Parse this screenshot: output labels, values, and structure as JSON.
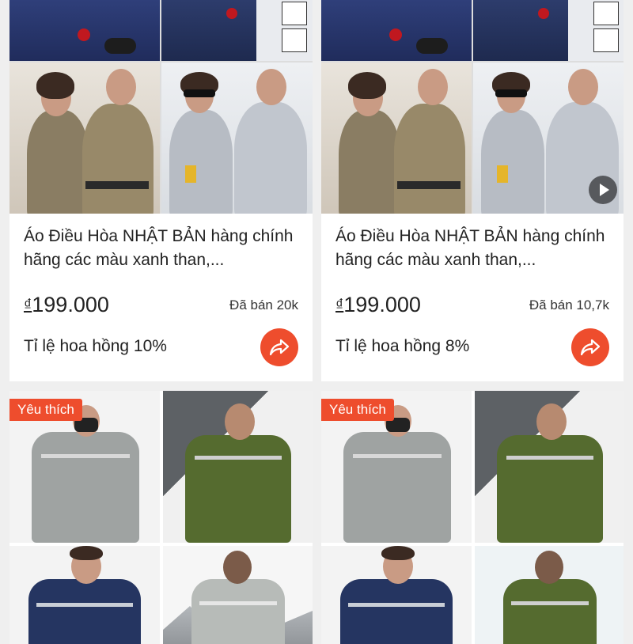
{
  "products": [
    {
      "title": "Áo Điều Hòa NHẬT BẢN hàng chính hãng các màu xanh than,...",
      "currency": "₫",
      "price": "199.000",
      "sold": "Đã bán 20k",
      "commission": "Tỉ lệ hoa hồng 10%",
      "has_video": false
    },
    {
      "title": "Áo Điều Hòa NHẬT BẢN hàng chính hãng các màu xanh than,...",
      "currency": "₫",
      "price": "199.000",
      "sold": "Đã bán 10,7k",
      "commission": "Tỉ lệ hoa hồng 8%",
      "has_video": true
    },
    {
      "favorite_badge": "Yêu thích"
    },
    {
      "favorite_badge": "Yêu thích"
    }
  ],
  "icons": {
    "share": "share-arrow-icon",
    "play": "play-icon"
  },
  "colors": {
    "accent": "#ee4d2d",
    "background": "#efefef"
  }
}
